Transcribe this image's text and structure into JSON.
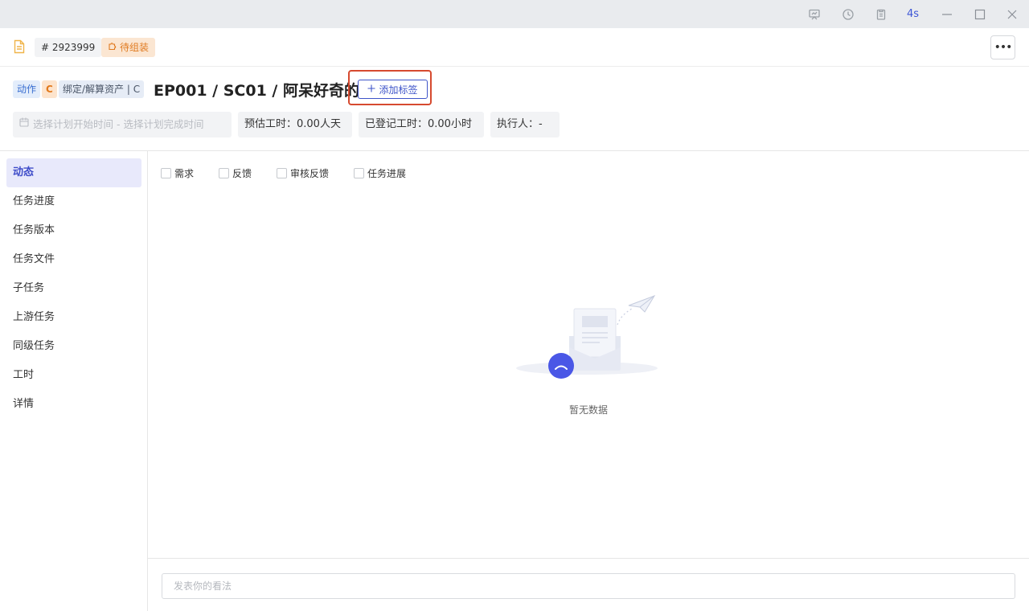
{
  "titlebar": {
    "timer": "4s",
    "icons": [
      "presentation-icon",
      "history-icon",
      "clipboard-icon"
    ]
  },
  "header": {
    "id_label": "# 2923999",
    "status_label": "待组装"
  },
  "task": {
    "tags": [
      "动作",
      "C",
      "绑定/解算资产 | C"
    ],
    "title": "EP001 / SC01 / 阿呆好奇的看",
    "add_tag_label": "添加标签",
    "date_placeholder": "选择计划开始时间 - 选择计划完成时间",
    "estimate": "预估工时：0.00人天",
    "logged": "已登记工时：0.00小时",
    "assignee": "执行人：-"
  },
  "sidebar": {
    "items": [
      {
        "label": "动态"
      },
      {
        "label": "任务进度"
      },
      {
        "label": "任务版本"
      },
      {
        "label": "任务文件"
      },
      {
        "label": "子任务"
      },
      {
        "label": "上游任务"
      },
      {
        "label": "同级任务"
      },
      {
        "label": "工时"
      },
      {
        "label": "详情"
      }
    ]
  },
  "filters": {
    "items": [
      {
        "label": "需求"
      },
      {
        "label": "反馈"
      },
      {
        "label": "审核反馈"
      },
      {
        "label": "任务进展"
      }
    ]
  },
  "empty": {
    "text": "暂无数据"
  },
  "comment": {
    "placeholder": "发表你的看法"
  },
  "colors": {
    "accent": "#3f55c9",
    "status_orange": "#e07b21",
    "highlight_red": "#d64a2f"
  }
}
